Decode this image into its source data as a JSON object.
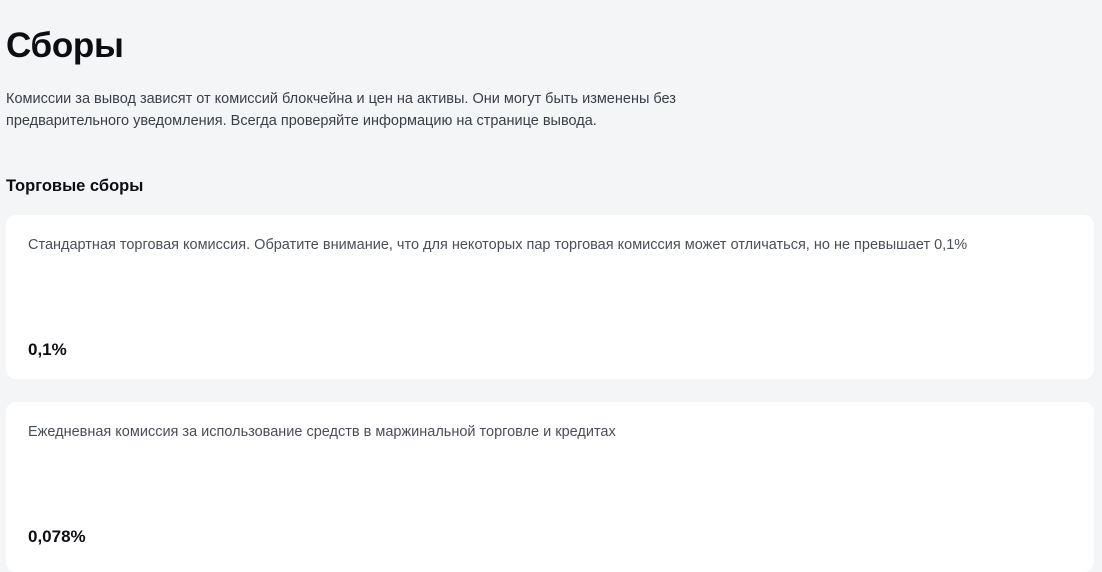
{
  "page": {
    "title": "Сборы",
    "intro": "Комиссии за вывод зависят от комиссий блокчейна и цен на активы. Они могут быть изменены без предварительного уведомления. Всегда проверяйте информацию на странице вывода."
  },
  "trading_fees": {
    "heading": "Торговые сборы",
    "cards": [
      {
        "description": "Стандартная торговая комиссия. Обратите внимание, что для некоторых пар торговая комиссия может отличаться, но не превышает 0,1%",
        "value": "0,1%"
      },
      {
        "description": "Ежедневная комиссия за использование средств в маржинальной торговле и кредитах",
        "value": "0,078%"
      }
    ]
  }
}
